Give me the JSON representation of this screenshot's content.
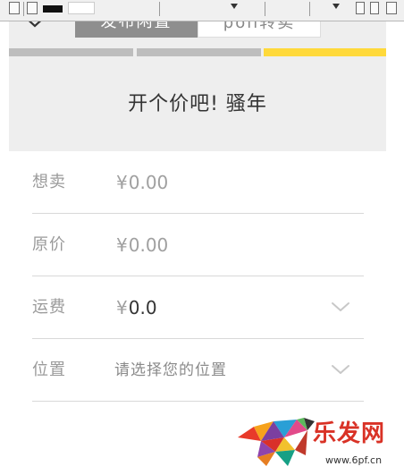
{
  "segments": [
    {
      "label": "发布闲置"
    },
    {
      "label": "poll转卖"
    }
  ],
  "heading": "开个价吧! 骚年",
  "form": {
    "want_price": {
      "label": "想卖",
      "currency": "¥",
      "value": "0.00"
    },
    "original_price": {
      "label": "原价",
      "currency": "¥",
      "value": "0.00"
    },
    "shipping": {
      "label": "运费",
      "currency": "¥",
      "value": "0.0"
    },
    "location": {
      "label": "位置",
      "placeholder": "请选择您的位置"
    }
  },
  "watermark": {
    "logo_text": "乐发网",
    "url": "www.6pf.cn"
  },
  "colors": {
    "accent": "#ffd93b",
    "segment_active": "#8e8e8e",
    "progress_inactive": "#bdbdbd",
    "watermark_red": "#d93226"
  }
}
